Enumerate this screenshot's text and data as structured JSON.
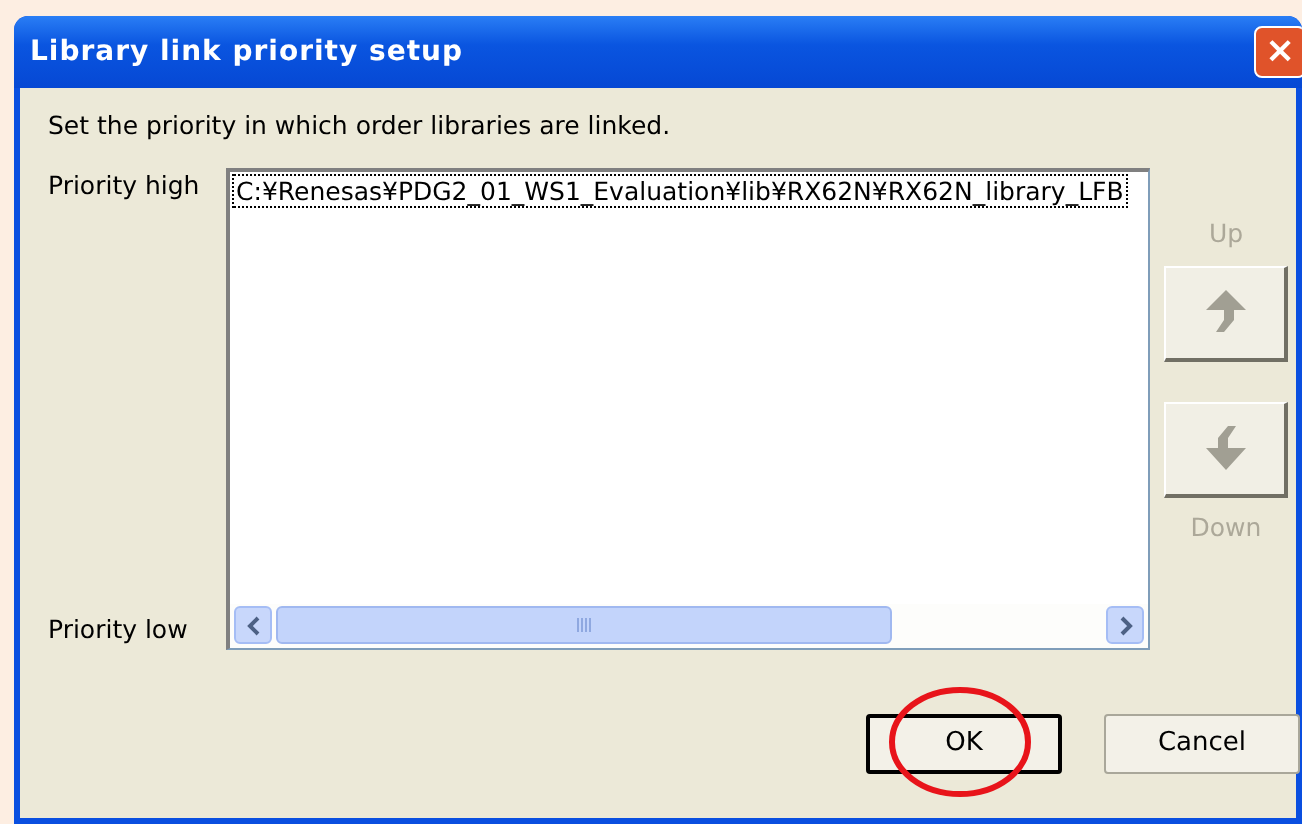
{
  "window": {
    "title": "Library link priority setup",
    "close": "×"
  },
  "instruction": "Set the priority in which order libraries are linked.",
  "priority_high_label": "Priority high",
  "priority_low_label": "Priority low",
  "list": {
    "items": [
      {
        "text": "C:¥Renesas¥PDG2_01_WS1_Evaluation¥lib¥RX62N¥RX62N_library_LFB",
        "selected": true
      }
    ]
  },
  "move_buttons": [
    {
      "kind": "up",
      "label": "Up",
      "disabled": true
    },
    {
      "kind": "down",
      "label": "Down",
      "disabled": true
    }
  ],
  "buttons": [
    {
      "label": "OK",
      "default": true,
      "circled": true
    },
    {
      "label": "Cancel",
      "default": false,
      "circled": false
    }
  ]
}
